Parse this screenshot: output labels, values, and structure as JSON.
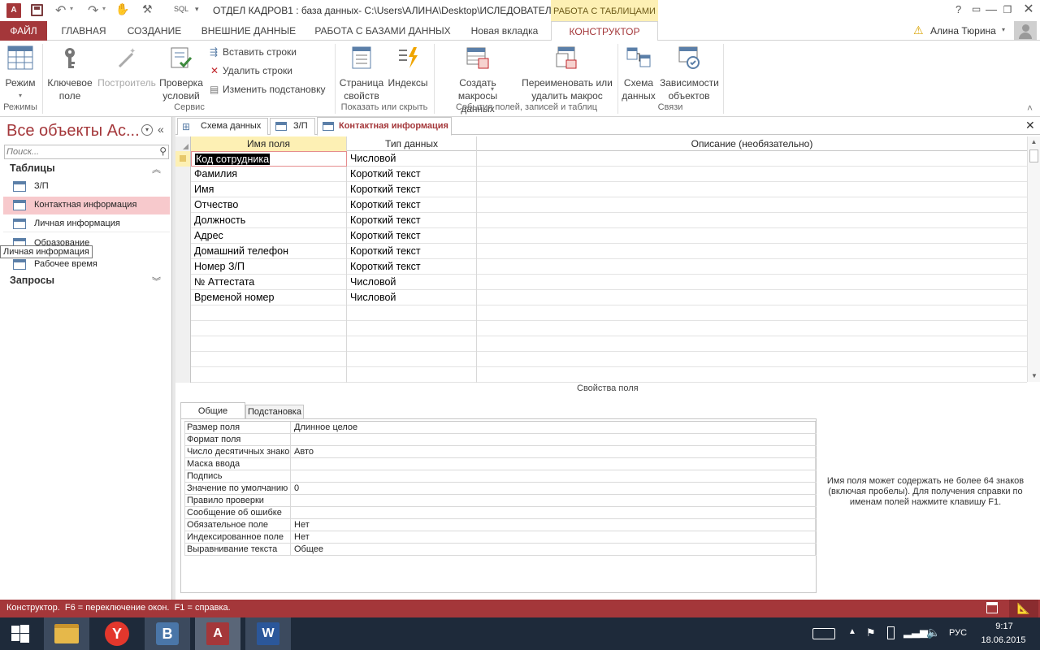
{
  "window": {
    "title": "ОТДЕЛ КАДРОВ1 : база данных- C:\\Users\\АЛИНА\\Desktop\\ИСЛЕДОВАТЕЛ...",
    "context_tab": "РАБОТА С ТАБЛИЦАМИ",
    "qat_sql": "SQL",
    "user": "Алина Тюрина"
  },
  "ribbon_tabs": [
    "ФАЙЛ",
    "ГЛАВНАЯ",
    "СОЗДАНИЕ",
    "ВНЕШНИЕ ДАННЫЕ",
    "РАБОТА С БАЗАМИ ДАННЫХ",
    "Новая вкладка",
    "КОНСТРУКТОР"
  ],
  "ribbon": {
    "mode_label": "Режим",
    "group_modes": "Режимы",
    "key_label": "Ключевое поле",
    "builder_label": "Построитель",
    "check_label": "Проверка условий",
    "insert_rows": "Вставить строки",
    "delete_rows": "Удалить строки",
    "change_lookup": "Изменить подстановку",
    "group_service": "Сервис",
    "prop_sheet": "Страница свойств",
    "indexes": "Индексы",
    "group_show": "Показать или скрыть",
    "create_macros": "Создать макросы данных",
    "rename_macro": "Переименовать или удалить макрос",
    "group_events": "События полей, записей и таблиц",
    "schema": "Схема данных",
    "dependencies": "Зависимости объектов",
    "group_links": "Связи"
  },
  "nav": {
    "title": "Все объекты Ac...",
    "search_placeholder": "Поиск...",
    "tables_header": "Таблицы",
    "tables": [
      "З/П",
      "Контактная информация",
      "Личная информация",
      "Образование",
      "Рабочее время"
    ],
    "queries_header": "Запросы",
    "tooltip": "Личная информация"
  },
  "doc_tabs": [
    "Схема данных",
    "З/П",
    "Контактная информация"
  ],
  "grid": {
    "headers": [
      "Имя поля",
      "Тип данных",
      "Описание (необязательно)"
    ],
    "rows": [
      [
        "Код сотрудника",
        "Числовой"
      ],
      [
        "Фамилия",
        "Короткий текст"
      ],
      [
        "Имя",
        "Короткий текст"
      ],
      [
        "Отчество",
        "Короткий текст"
      ],
      [
        "Должность",
        "Короткий текст"
      ],
      [
        "Адрес",
        "Короткий текст"
      ],
      [
        "Домашний телефон",
        "Короткий текст"
      ],
      [
        "Номер З/П",
        "Короткий текст"
      ],
      [
        "№ Аттестата",
        "Числовой"
      ],
      [
        "Временой номер",
        "Числовой"
      ]
    ]
  },
  "props": {
    "title": "Свойства поля",
    "tab_general": "Общие",
    "tab_lookup": "Подстановка",
    "rows": [
      [
        "Размер поля",
        "Длинное целое"
      ],
      [
        "Формат поля",
        ""
      ],
      [
        "Число десятичных знаков",
        "Авто"
      ],
      [
        "Маска ввода",
        ""
      ],
      [
        "Подпись",
        ""
      ],
      [
        "Значение по умолчанию",
        "0"
      ],
      [
        "Правило проверки",
        ""
      ],
      [
        "Сообщение об ошибке",
        ""
      ],
      [
        "Обязательное поле",
        "Нет"
      ],
      [
        "Индексированное поле",
        "Нет"
      ],
      [
        "Выравнивание текста",
        "Общее"
      ]
    ],
    "help": "Имя поля может содержать не более 64 знаков (включая пробелы). Для получения справки по именам полей нажмите клавишу F1."
  },
  "status": {
    "text": "Конструктор.  F6 = переключение окон.  F1 = справка."
  },
  "taskbar": {
    "lang": "РУС",
    "time": "9:17",
    "date": "18.06.2015"
  },
  "colors": {
    "accent": "#a4373a",
    "file_tab": "#a4373a",
    "context": "#fdf0b4",
    "selected_nav": "#f7c9cc"
  }
}
